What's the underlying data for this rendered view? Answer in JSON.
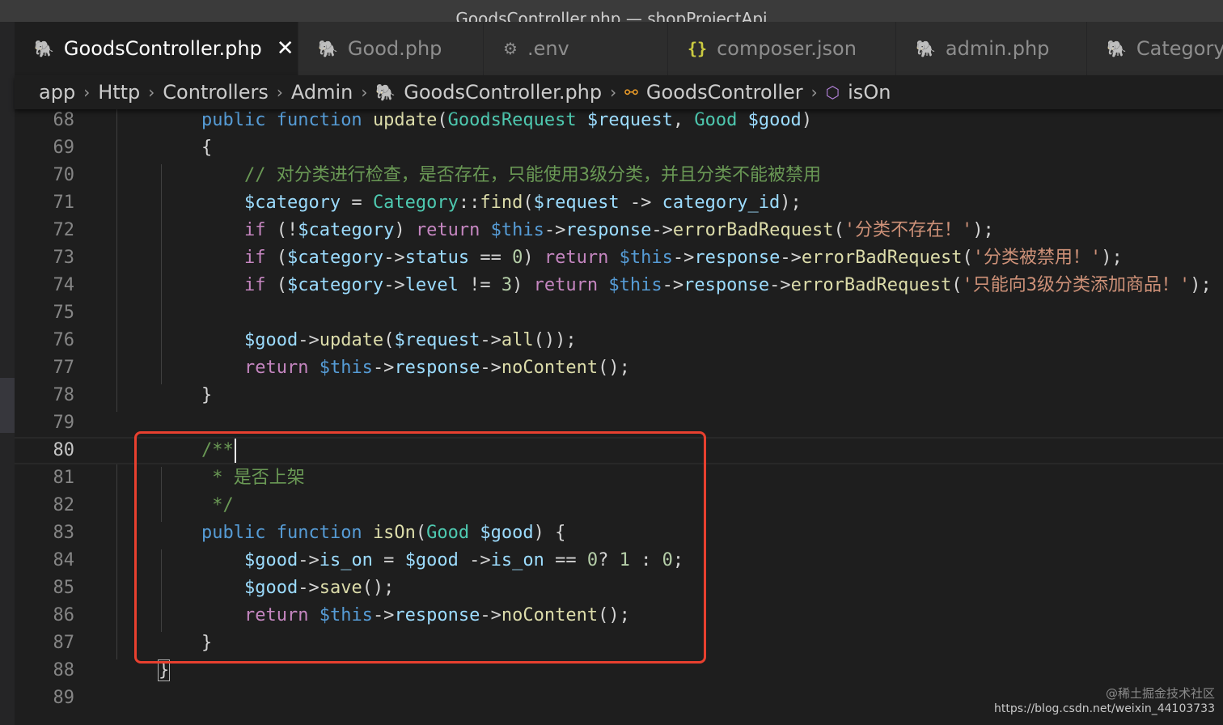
{
  "window": {
    "title": "GoodsController.php — shopProjectApi"
  },
  "tabs": [
    {
      "label": "GoodsController.php",
      "icon": "php-elephant-icon",
      "active": true
    },
    {
      "label": "Good.php",
      "icon": "php-elephant-icon",
      "active": false
    },
    {
      "label": ".env",
      "icon": "gear-icon",
      "active": false
    },
    {
      "label": "composer.json",
      "icon": "json-braces-icon",
      "active": false
    },
    {
      "label": "admin.php",
      "icon": "php-elephant-icon",
      "active": false
    },
    {
      "label": "Category",
      "icon": "php-elephant-icon",
      "active": false
    }
  ],
  "tab_close_glyph": "✕",
  "breadcrumb": [
    {
      "label": "app"
    },
    {
      "label": "Http"
    },
    {
      "label": "Controllers"
    },
    {
      "label": "Admin"
    },
    {
      "label": "GoodsController.php",
      "icon": "php-elephant-icon"
    },
    {
      "label": "GoodsController",
      "icon": "class-symbol-icon"
    },
    {
      "label": "isOn",
      "icon": "method-symbol-icon"
    }
  ],
  "editor": {
    "current_line": "80",
    "lines": [
      {
        "n": "68",
        "tokens": [
          [
            "pun",
            "    "
          ],
          [
            "kw",
            "public"
          ],
          [
            "pun",
            " "
          ],
          [
            "kw",
            "function"
          ],
          [
            "pun",
            " "
          ],
          [
            "fn",
            "update"
          ],
          [
            "pun",
            "("
          ],
          [
            "cls",
            "GoodsRequest"
          ],
          [
            "pun",
            " "
          ],
          [
            "var",
            "$request"
          ],
          [
            "pun",
            ", "
          ],
          [
            "cls",
            "Good"
          ],
          [
            "pun",
            " "
          ],
          [
            "var",
            "$good"
          ],
          [
            "pun",
            ")"
          ]
        ]
      },
      {
        "n": "69",
        "tokens": [
          [
            "pun",
            "    {"
          ]
        ]
      },
      {
        "n": "70",
        "tokens": [
          [
            "pun",
            "        "
          ],
          [
            "com",
            "// 对分类进行检查，是否存在，只能使用3级分类，并且分类不能被禁用"
          ]
        ]
      },
      {
        "n": "71",
        "tokens": [
          [
            "pun",
            "        "
          ],
          [
            "var",
            "$category"
          ],
          [
            "pun",
            " = "
          ],
          [
            "cls",
            "Category"
          ],
          [
            "pun",
            "::"
          ],
          [
            "fn",
            "find"
          ],
          [
            "pun",
            "("
          ],
          [
            "var",
            "$request"
          ],
          [
            "pun",
            " -> "
          ],
          [
            "var",
            "category_id"
          ],
          [
            "pun",
            ");"
          ]
        ]
      },
      {
        "n": "72",
        "tokens": [
          [
            "pun",
            "        "
          ],
          [
            "ctl",
            "if"
          ],
          [
            "pun",
            " (!"
          ],
          [
            "var",
            "$category"
          ],
          [
            "pun",
            ") "
          ],
          [
            "ctl",
            "return"
          ],
          [
            "pun",
            " "
          ],
          [
            "this",
            "$this"
          ],
          [
            "pun",
            "->"
          ],
          [
            "var",
            "response"
          ],
          [
            "pun",
            "->"
          ],
          [
            "fn",
            "errorBadRequest"
          ],
          [
            "pun",
            "("
          ],
          [
            "str",
            "'分类不存在！'"
          ],
          [
            "pun",
            ");"
          ]
        ]
      },
      {
        "n": "73",
        "tokens": [
          [
            "pun",
            "        "
          ],
          [
            "ctl",
            "if"
          ],
          [
            "pun",
            " ("
          ],
          [
            "var",
            "$category"
          ],
          [
            "pun",
            "->"
          ],
          [
            "var",
            "status"
          ],
          [
            "pun",
            " == "
          ],
          [
            "num",
            "0"
          ],
          [
            "pun",
            ") "
          ],
          [
            "ctl",
            "return"
          ],
          [
            "pun",
            " "
          ],
          [
            "this",
            "$this"
          ],
          [
            "pun",
            "->"
          ],
          [
            "var",
            "response"
          ],
          [
            "pun",
            "->"
          ],
          [
            "fn",
            "errorBadRequest"
          ],
          [
            "pun",
            "("
          ],
          [
            "str",
            "'分类被禁用！'"
          ],
          [
            "pun",
            ");"
          ]
        ]
      },
      {
        "n": "74",
        "tokens": [
          [
            "pun",
            "        "
          ],
          [
            "ctl",
            "if"
          ],
          [
            "pun",
            " ("
          ],
          [
            "var",
            "$category"
          ],
          [
            "pun",
            "->"
          ],
          [
            "var",
            "level"
          ],
          [
            "pun",
            " != "
          ],
          [
            "num",
            "3"
          ],
          [
            "pun",
            ") "
          ],
          [
            "ctl",
            "return"
          ],
          [
            "pun",
            " "
          ],
          [
            "this",
            "$this"
          ],
          [
            "pun",
            "->"
          ],
          [
            "var",
            "response"
          ],
          [
            "pun",
            "->"
          ],
          [
            "fn",
            "errorBadRequest"
          ],
          [
            "pun",
            "("
          ],
          [
            "str",
            "'只能向3级分类添加商品！'"
          ],
          [
            "pun",
            ");"
          ]
        ]
      },
      {
        "n": "75",
        "tokens": []
      },
      {
        "n": "76",
        "tokens": [
          [
            "pun",
            "        "
          ],
          [
            "var",
            "$good"
          ],
          [
            "pun",
            "->"
          ],
          [
            "fn",
            "update"
          ],
          [
            "pun",
            "("
          ],
          [
            "var",
            "$request"
          ],
          [
            "pun",
            "->"
          ],
          [
            "fn",
            "all"
          ],
          [
            "pun",
            "());"
          ]
        ]
      },
      {
        "n": "77",
        "tokens": [
          [
            "pun",
            "        "
          ],
          [
            "ctl",
            "return"
          ],
          [
            "pun",
            " "
          ],
          [
            "this",
            "$this"
          ],
          [
            "pun",
            "->"
          ],
          [
            "var",
            "response"
          ],
          [
            "pun",
            "->"
          ],
          [
            "fn",
            "noContent"
          ],
          [
            "pun",
            "();"
          ]
        ]
      },
      {
        "n": "78",
        "tokens": [
          [
            "pun",
            "    }"
          ]
        ]
      },
      {
        "n": "79",
        "tokens": []
      },
      {
        "n": "80",
        "tokens": [
          [
            "pun",
            "    "
          ],
          [
            "com",
            "/**"
          ]
        ],
        "cursor": true
      },
      {
        "n": "81",
        "tokens": [
          [
            "pun",
            "     "
          ],
          [
            "com",
            "* 是否上架"
          ]
        ]
      },
      {
        "n": "82",
        "tokens": [
          [
            "pun",
            "     "
          ],
          [
            "com",
            "*/"
          ]
        ]
      },
      {
        "n": "83",
        "tokens": [
          [
            "pun",
            "    "
          ],
          [
            "kw",
            "public"
          ],
          [
            "pun",
            " "
          ],
          [
            "kw",
            "function"
          ],
          [
            "pun",
            " "
          ],
          [
            "fn",
            "isOn"
          ],
          [
            "pun",
            "("
          ],
          [
            "cls",
            "Good"
          ],
          [
            "pun",
            " "
          ],
          [
            "var",
            "$good"
          ],
          [
            "pun",
            ") {"
          ]
        ]
      },
      {
        "n": "84",
        "tokens": [
          [
            "pun",
            "        "
          ],
          [
            "var",
            "$good"
          ],
          [
            "pun",
            "->"
          ],
          [
            "var",
            "is_on"
          ],
          [
            "pun",
            " = "
          ],
          [
            "var",
            "$good"
          ],
          [
            "pun",
            " ->"
          ],
          [
            "var",
            "is_on"
          ],
          [
            "pun",
            " == "
          ],
          [
            "num",
            "0"
          ],
          [
            "pun",
            "? "
          ],
          [
            "num",
            "1"
          ],
          [
            "pun",
            " : "
          ],
          [
            "num",
            "0"
          ],
          [
            "pun",
            ";"
          ]
        ]
      },
      {
        "n": "85",
        "tokens": [
          [
            "pun",
            "        "
          ],
          [
            "var",
            "$good"
          ],
          [
            "pun",
            "->"
          ],
          [
            "fn",
            "save"
          ],
          [
            "pun",
            "();"
          ]
        ]
      },
      {
        "n": "86",
        "tokens": [
          [
            "pun",
            "        "
          ],
          [
            "ctl",
            "return"
          ],
          [
            "pun",
            " "
          ],
          [
            "this",
            "$this"
          ],
          [
            "pun",
            "->"
          ],
          [
            "var",
            "response"
          ],
          [
            "pun",
            "->"
          ],
          [
            "fn",
            "noContent"
          ],
          [
            "pun",
            "();"
          ]
        ]
      },
      {
        "n": "87",
        "tokens": [
          [
            "pun",
            "    }"
          ]
        ]
      },
      {
        "n": "88",
        "tokens": [
          [
            "bracket",
            "}"
          ]
        ]
      },
      {
        "n": "89",
        "tokens": []
      }
    ]
  },
  "annotation": {
    "color": "#e8402f"
  },
  "watermark": {
    "line1": "@稀土掘金技术社区",
    "line2": "https://blog.csdn.net/weixin_44103733"
  }
}
